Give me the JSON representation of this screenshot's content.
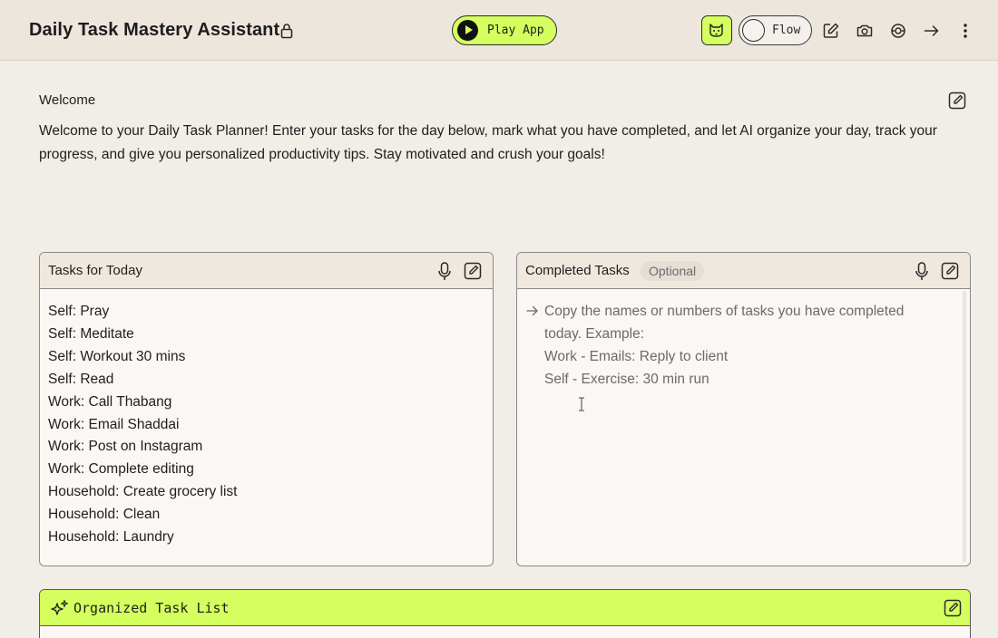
{
  "header": {
    "title": "Daily Task Mastery Assistant",
    "play_label": "Play App",
    "flow_label": "Flow"
  },
  "welcome": {
    "title": "Welcome",
    "text": "Welcome to your Daily Task Planner! Enter your tasks for the day below, mark what you have completed, and let AI organize your day, track your progress, and give you personalized productivity tips. Stay motivated and crush your goals!"
  },
  "tasks_card": {
    "title": "Tasks for Today",
    "lines": [
      "Self: Pray",
      "Self: Meditate",
      "Self: Workout 30 mins",
      "Self: Read",
      "Work: Call Thabang",
      "Work: Email Shaddai",
      "Work: Post on Instagram",
      "Work: Complete editing",
      "Household: Create grocery list",
      "Household: Clean",
      "Household: Laundry"
    ]
  },
  "completed_card": {
    "title": "Completed Tasks",
    "badge": "Optional",
    "placeholder_lines": [
      "Copy the names or numbers of tasks you have completed today. Example:",
      "Work - Emails: Reply to client",
      "Self - Exercise: 30 min run"
    ]
  },
  "organized_card": {
    "title": "Organized Task List"
  },
  "colors": {
    "accent": "#d4ff5e",
    "background": "#f1ede7",
    "header": "#ece6dd"
  },
  "icons": [
    "lock-icon",
    "play-icon",
    "cat-icon",
    "edit-icon",
    "camera-icon",
    "broadcast-icon",
    "share-arrow-icon",
    "more-vertical-icon",
    "mic-icon",
    "sparkle-icon",
    "arrow-right-icon",
    "text-cursor-icon"
  ]
}
